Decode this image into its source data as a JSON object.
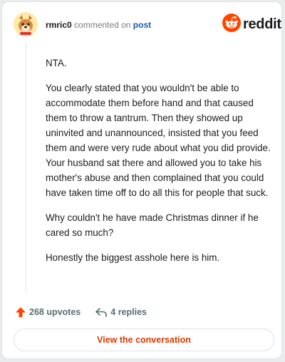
{
  "header": {
    "username": "rmric0",
    "action": "commented on",
    "target": "post",
    "brand": "reddit"
  },
  "icons": {
    "avatar": "dog-avatar-icon",
    "logo": "reddit-alien-icon",
    "upvote": "upvote-arrow-icon",
    "reply": "reply-arrow-icon"
  },
  "colors": {
    "upvote": "#ff4500",
    "link": "#1a59b5",
    "cta": "#d93a00"
  },
  "comment": {
    "paragraphs": [
      "NTA.",
      "You clearly stated that you wouldn't be able to accommodate them before hand and that caused them to throw a tantrum. Then they showed up uninvited and unannounced, insisted that you feed them and were very rude about what you did provide. Your husband sat there and allowed you to take his mother's abuse and then complained that you could have taken time off to do all this for people that suck.",
      "Why couldn't he have made Christmas dinner if he cared so much?",
      "Honestly the biggest asshole here is him."
    ]
  },
  "footer": {
    "upvotes": "268 upvotes",
    "replies": "4 replies"
  },
  "cta": {
    "label": "View the conversation"
  }
}
